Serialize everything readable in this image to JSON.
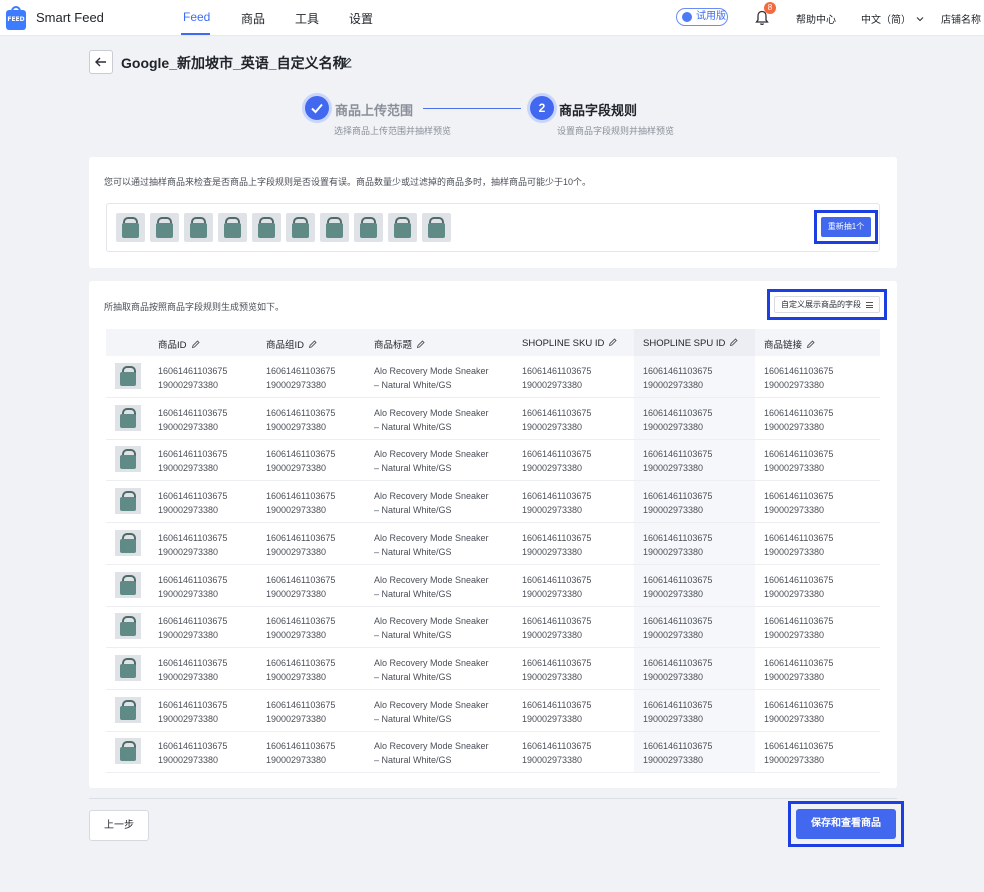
{
  "app": {
    "logo_text": "FEED",
    "name": "Smart Feed"
  },
  "nav": [
    {
      "label": "Feed",
      "active": true
    },
    {
      "label": "商品",
      "active": false
    },
    {
      "label": "工具",
      "active": false
    },
    {
      "label": "设置",
      "active": false
    }
  ],
  "header": {
    "trial_label": "试用版",
    "notification_count": "8",
    "help_label": "帮助中心",
    "language_label": "中文（简）",
    "store_label": "店铺名称"
  },
  "page": {
    "title": "Google_新加坡市_英语_自定义名称"
  },
  "steps": [
    {
      "index": "1",
      "title": "商品上传范围",
      "desc": "选择商品上传范围并抽样预览",
      "state": "done"
    },
    {
      "index": "2",
      "title": "商品字段规则",
      "desc": "设置商品字段规则并抽样预览",
      "state": "active"
    }
  ],
  "sampling": {
    "description": "您可以通过抽样商品来检查是否商品上字段规则是否设置有误。商品数量少或过滤掉的商品多时，抽样商品可能少于10个。",
    "sample_count": 10,
    "resample_label": "重新抽1个"
  },
  "preview": {
    "description": "所抽取商品按照商品字段规则生成预览如下。",
    "custom_fields_label": "自定义展示商品的字段",
    "columns": [
      "商品ID",
      "商品组ID",
      "商品标题",
      "SHOPLINE SKU ID",
      "SHOPLINE SPU ID",
      "商品链接"
    ],
    "rows": [
      {
        "product_id": [
          "16061461103675",
          "190002973380"
        ],
        "group_id": [
          "16061461103675",
          "190002973380"
        ],
        "title": [
          "Alo Recovery Mode Sneaker",
          "– Natural White/GS"
        ],
        "sku_id": [
          "16061461103675",
          "190002973380"
        ],
        "spu_id": [
          "16061461103675",
          "190002973380"
        ],
        "link": [
          "16061461103675",
          "190002973380"
        ]
      },
      {
        "product_id": [
          "16061461103675",
          "190002973380"
        ],
        "group_id": [
          "16061461103675",
          "190002973380"
        ],
        "title": [
          "Alo Recovery Mode Sneaker",
          "– Natural White/GS"
        ],
        "sku_id": [
          "16061461103675",
          "190002973380"
        ],
        "spu_id": [
          "16061461103675",
          "190002973380"
        ],
        "link": [
          "16061461103675",
          "190002973380"
        ]
      },
      {
        "product_id": [
          "16061461103675",
          "190002973380"
        ],
        "group_id": [
          "16061461103675",
          "190002973380"
        ],
        "title": [
          "Alo Recovery Mode Sneaker",
          "– Natural White/GS"
        ],
        "sku_id": [
          "16061461103675",
          "190002973380"
        ],
        "spu_id": [
          "16061461103675",
          "190002973380"
        ],
        "link": [
          "16061461103675",
          "190002973380"
        ]
      },
      {
        "product_id": [
          "16061461103675",
          "190002973380"
        ],
        "group_id": [
          "16061461103675",
          "190002973380"
        ],
        "title": [
          "Alo Recovery Mode Sneaker",
          "– Natural White/GS"
        ],
        "sku_id": [
          "16061461103675",
          "190002973380"
        ],
        "spu_id": [
          "16061461103675",
          "190002973380"
        ],
        "link": [
          "16061461103675",
          "190002973380"
        ]
      },
      {
        "product_id": [
          "16061461103675",
          "190002973380"
        ],
        "group_id": [
          "16061461103675",
          "190002973380"
        ],
        "title": [
          "Alo Recovery Mode Sneaker",
          "– Natural White/GS"
        ],
        "sku_id": [
          "16061461103675",
          "190002973380"
        ],
        "spu_id": [
          "16061461103675",
          "190002973380"
        ],
        "link": [
          "16061461103675",
          "190002973380"
        ]
      },
      {
        "product_id": [
          "16061461103675",
          "190002973380"
        ],
        "group_id": [
          "16061461103675",
          "190002973380"
        ],
        "title": [
          "Alo Recovery Mode Sneaker",
          "– Natural White/GS"
        ],
        "sku_id": [
          "16061461103675",
          "190002973380"
        ],
        "spu_id": [
          "16061461103675",
          "190002973380"
        ],
        "link": [
          "16061461103675",
          "190002973380"
        ]
      },
      {
        "product_id": [
          "16061461103675",
          "190002973380"
        ],
        "group_id": [
          "16061461103675",
          "190002973380"
        ],
        "title": [
          "Alo Recovery Mode Sneaker",
          "– Natural White/GS"
        ],
        "sku_id": [
          "16061461103675",
          "190002973380"
        ],
        "spu_id": [
          "16061461103675",
          "190002973380"
        ],
        "link": [
          "16061461103675",
          "190002973380"
        ]
      },
      {
        "product_id": [
          "16061461103675",
          "190002973380"
        ],
        "group_id": [
          "16061461103675",
          "190002973380"
        ],
        "title": [
          "Alo Recovery Mode Sneaker",
          "– Natural White/GS"
        ],
        "sku_id": [
          "16061461103675",
          "190002973380"
        ],
        "spu_id": [
          "16061461103675",
          "190002973380"
        ],
        "link": [
          "16061461103675",
          "190002973380"
        ]
      },
      {
        "product_id": [
          "16061461103675",
          "190002973380"
        ],
        "group_id": [
          "16061461103675",
          "190002973380"
        ],
        "title": [
          "Alo Recovery Mode Sneaker",
          "– Natural White/GS"
        ],
        "sku_id": [
          "16061461103675",
          "190002973380"
        ],
        "spu_id": [
          "16061461103675",
          "190002973380"
        ],
        "link": [
          "16061461103675",
          "190002973380"
        ]
      },
      {
        "product_id": [
          "16061461103675",
          "190002973380"
        ],
        "group_id": [
          "16061461103675",
          "190002973380"
        ],
        "title": [
          "Alo Recovery Mode Sneaker",
          "– Natural White/GS"
        ],
        "sku_id": [
          "16061461103675",
          "190002973380"
        ],
        "spu_id": [
          "16061461103675",
          "190002973380"
        ],
        "link": [
          "16061461103675",
          "190002973380"
        ]
      }
    ]
  },
  "footer": {
    "prev_label": "上一步",
    "save_label": "保存和查看商品"
  },
  "colors": {
    "primary": "#4168ef",
    "highlight_border": "#1b3fe3",
    "badge": "#f36a3e"
  }
}
